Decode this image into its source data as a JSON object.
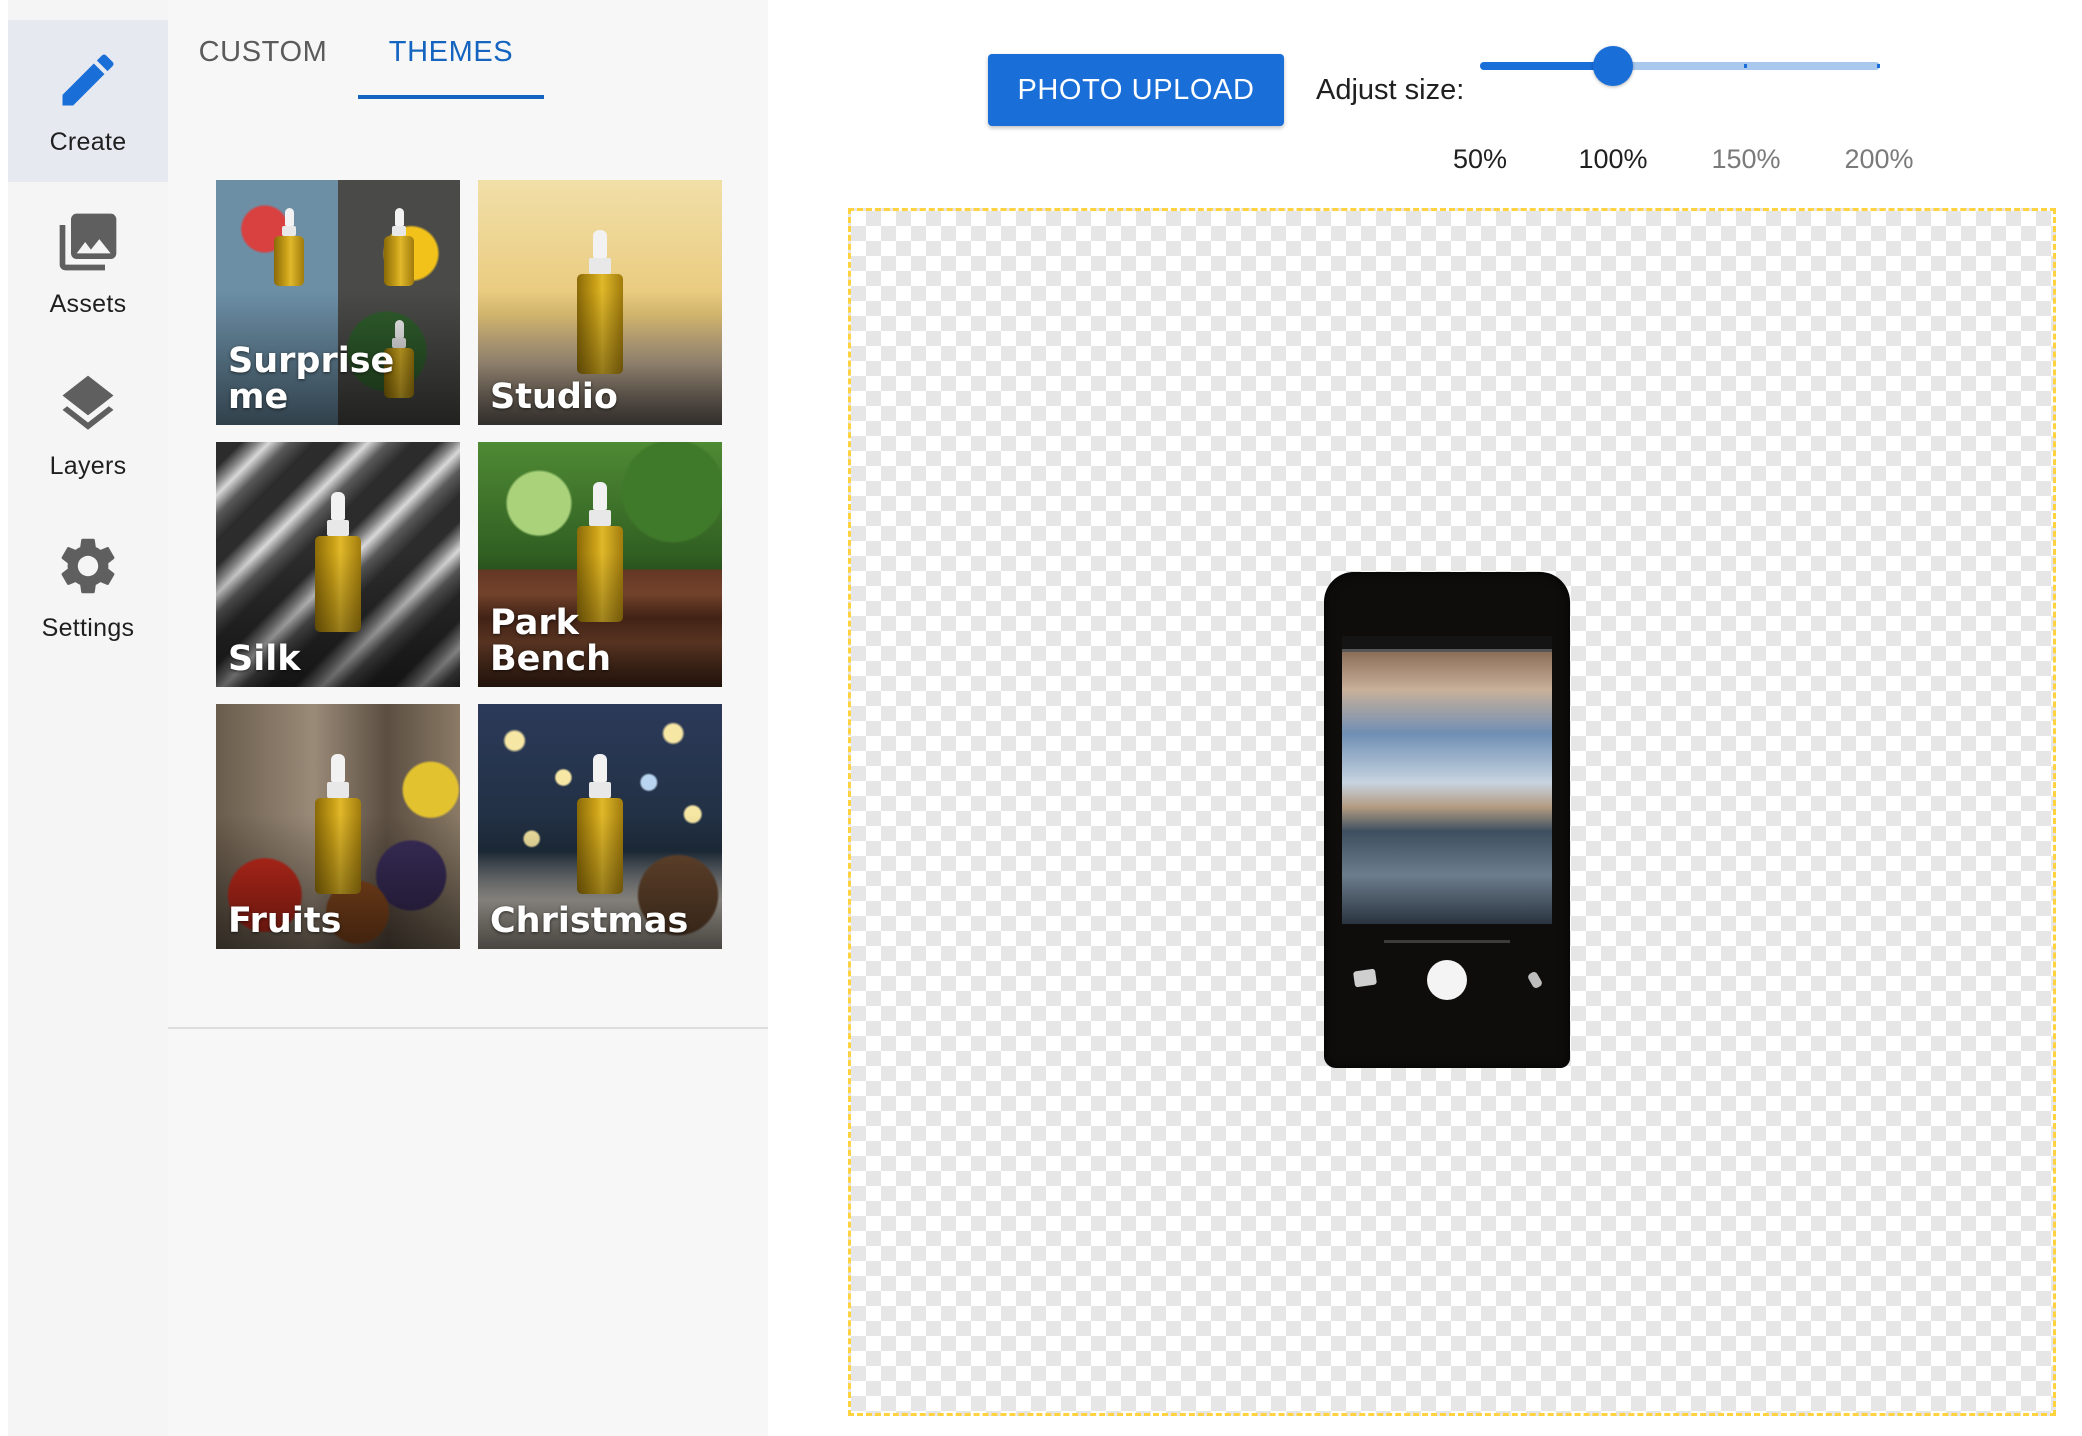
{
  "nav": {
    "items": [
      {
        "label": "Create",
        "icon": "pencil-icon",
        "active": true
      },
      {
        "label": "Assets",
        "icon": "image-stack-icon",
        "active": false
      },
      {
        "label": "Layers",
        "icon": "layers-icon",
        "active": false
      },
      {
        "label": "Settings",
        "icon": "gear-icon",
        "active": false
      }
    ]
  },
  "tabs": {
    "custom": "CUSTOM",
    "themes": "THEMES",
    "selected": "THEMES"
  },
  "themes": [
    {
      "label": "Surprise\nme",
      "scene": "surprise"
    },
    {
      "label": "Studio",
      "scene": "studio"
    },
    {
      "label": "Silk",
      "scene": "silk"
    },
    {
      "label": "Park\nBench",
      "scene": "park"
    },
    {
      "label": "Fruits",
      "scene": "fruits"
    },
    {
      "label": "Christmas",
      "scene": "christmas"
    }
  ],
  "toolbar": {
    "upload_label": "PHOTO UPLOAD",
    "adjust_label": "Adjust size:",
    "size_marks": [
      "50%",
      "100%",
      "150%",
      "200%"
    ],
    "size_value_percent": 100,
    "size_min_percent": 50,
    "size_max_percent": 200
  },
  "colors": {
    "accent": "#1a6ed8",
    "tab_active": "#1565c0",
    "canvas_border": "#ffd23f",
    "rail_active_bg": "#e6e9ef"
  }
}
